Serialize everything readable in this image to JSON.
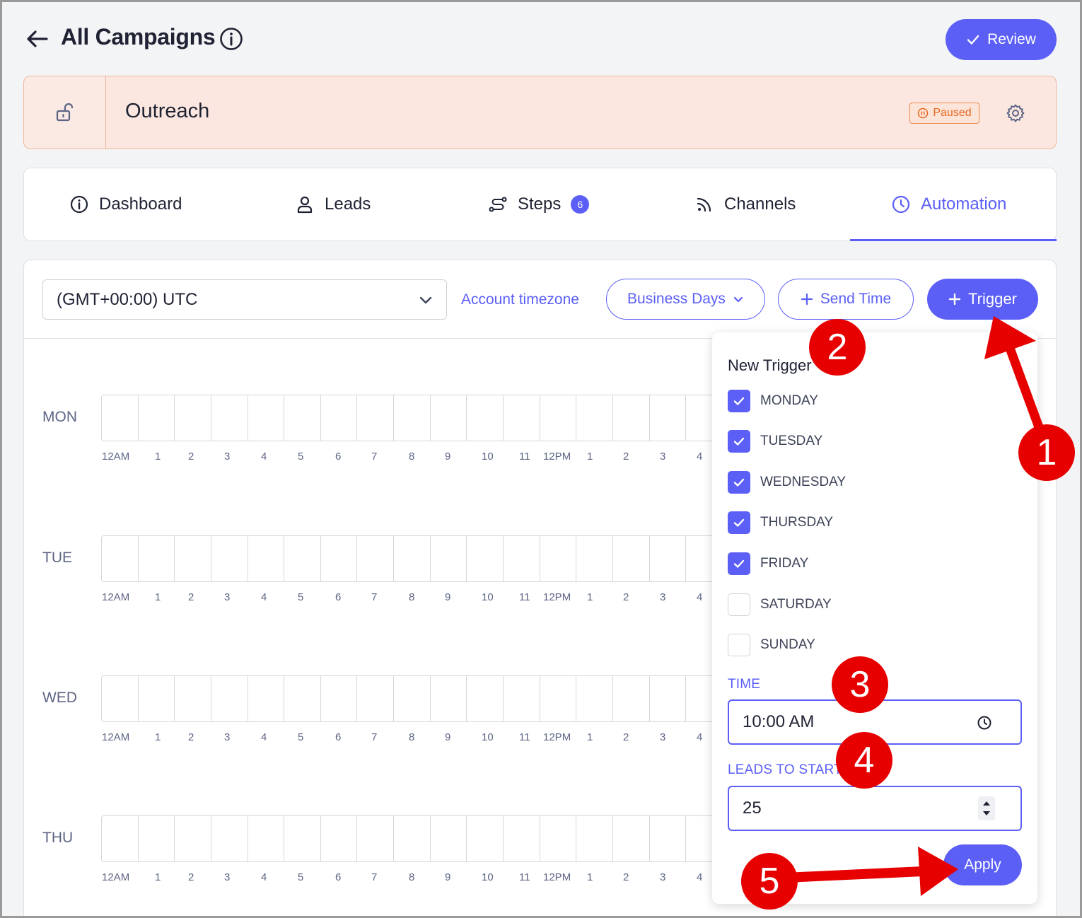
{
  "header": {
    "title": "All Campaigns",
    "review_label": "Review"
  },
  "campaign": {
    "name": "Outreach",
    "status": "Paused",
    "status_color": "#e8661e"
  },
  "tabs": [
    {
      "label": "Dashboard",
      "icon": "info-circle-icon",
      "active": false
    },
    {
      "label": "Leads",
      "icon": "user-icon",
      "active": false
    },
    {
      "label": "Steps",
      "icon": "steps-icon",
      "badge": "6",
      "active": false
    },
    {
      "label": "Channels",
      "icon": "rss-icon",
      "active": false
    },
    {
      "label": "Automation",
      "icon": "clock-icon",
      "active": true
    }
  ],
  "toolbar": {
    "timezone_value": "(GMT+00:00) UTC",
    "timezone_link": "Account timezone",
    "business_days_label": "Business Days",
    "send_time_label": "Send Time",
    "trigger_label": "Trigger"
  },
  "schedule": {
    "days": [
      "MON",
      "TUE",
      "WED",
      "THU"
    ],
    "hour_labels": [
      "12AM",
      "1",
      "2",
      "3",
      "4",
      "5",
      "6",
      "7",
      "8",
      "9",
      "10",
      "11",
      "12PM",
      "1",
      "2",
      "3",
      "4"
    ]
  },
  "trigger_popover": {
    "title": "New Trigger",
    "days": [
      {
        "label": "MONDAY",
        "checked": true
      },
      {
        "label": "TUESDAY",
        "checked": true
      },
      {
        "label": "WEDNESDAY",
        "checked": true
      },
      {
        "label": "THURSDAY",
        "checked": true
      },
      {
        "label": "FRIDAY",
        "checked": true
      },
      {
        "label": "SATURDAY",
        "checked": false
      },
      {
        "label": "SUNDAY",
        "checked": false
      }
    ],
    "time_label": "TIME",
    "time_value": "10:00 AM",
    "leads_label": "LEADS TO START",
    "leads_value": "25",
    "apply_label": "Apply"
  },
  "annotations": {
    "steps": [
      "1",
      "2",
      "3",
      "4",
      "5"
    ],
    "color": "#e60000"
  },
  "colors": {
    "accent": "#5b5ff5",
    "campaign_bg": "#fbe7e0"
  }
}
